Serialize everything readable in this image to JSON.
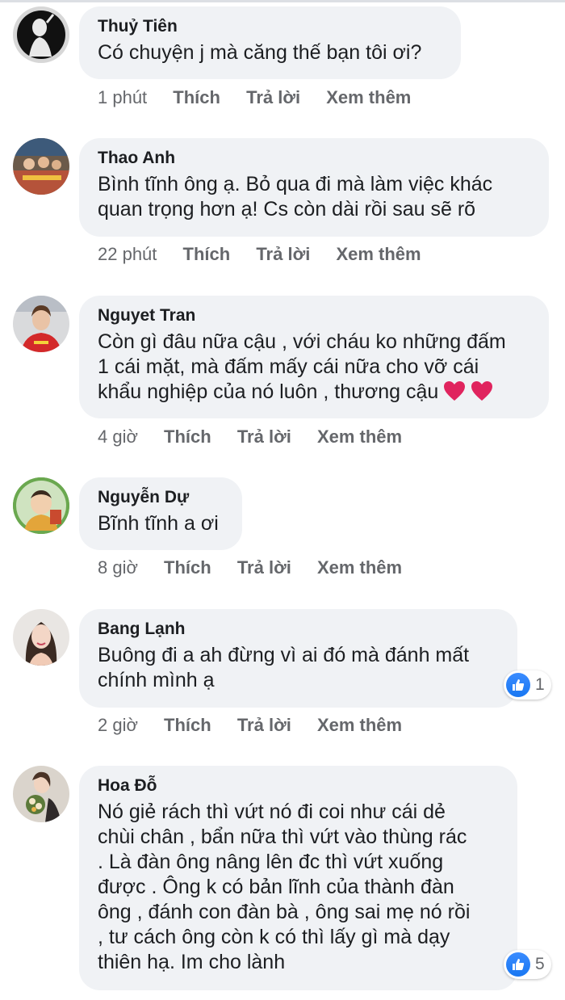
{
  "actions": {
    "like": "Thích",
    "reply": "Trả lời",
    "more": "Xem thêm"
  },
  "comments": [
    {
      "name": "Thuỷ Tiên",
      "text": "Có chuyện j mà căng thế bạn tôi ơi?",
      "time": "1 phút",
      "avatar": "silhouette-avatar"
    },
    {
      "name": "Thao Anh",
      "text": "Bình tĩnh ông ạ. Bỏ qua đi mà làm việc khác\nquan trọng hơn ạ! Cs còn dài rồi sau sẽ rõ",
      "time": "22 phút",
      "avatar": "group-photo-avatar"
    },
    {
      "name": "Nguyet Tran",
      "text": "Còn gì đâu nữa cậu , với cháu ko những đấm\n1 cái mặt, mà đấm mấy cái nữa cho vỡ cái\nkhẩu nghiệp của nó luôn , thương cậu",
      "time": "4 giờ",
      "avatar": "woman-red-shirt-avatar",
      "emoji": "❤️ ❤️"
    },
    {
      "name": "Nguyễn Dự",
      "text": "Bĩnh tĩnh a ơi",
      "time": "8 giờ",
      "avatar": "baby-avatar"
    },
    {
      "name": "Bang Lạnh",
      "text": "Buông đi a ah đừng vì ai đó mà đánh mất\nchính mình ạ",
      "time": "2 giờ",
      "avatar": "woman-portrait-avatar",
      "likes": "1"
    },
    {
      "name": "Hoa Đỗ",
      "text": "Nó giẻ rách thì vứt nó đi coi như cái dẻ\nchùi chân , bẩn nữa thì vứt vào thùng rác\n. Là đàn ông nâng lên đc thì vứt xuống\nđược . Ông k có bản lĩnh của thành đàn\nông , đánh con đàn bà , ông sai mẹ nó rồi\n, tư cách ông còn k có thì lấy gì mà dạy\nthiên hạ. Im cho lành",
      "time": "",
      "avatar": "flowers-avatar",
      "likes": "5"
    }
  ],
  "colors": {
    "bubble": "#f0f2f5",
    "meta": "#65676b",
    "like": "#1877f2",
    "heart": "#e0245e"
  }
}
